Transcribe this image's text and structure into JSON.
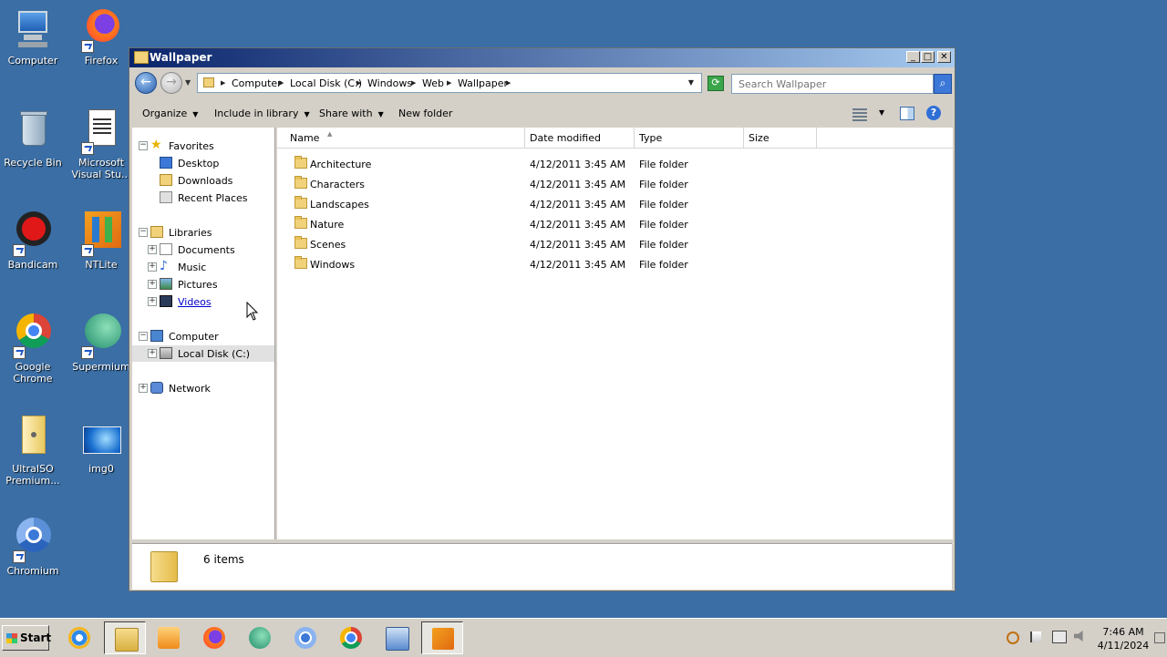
{
  "desktop": {
    "icons": [
      {
        "label": "Computer"
      },
      {
        "label": "Firefox"
      },
      {
        "label": "Recycle Bin"
      },
      {
        "label": "Microsoft Visual Stu..."
      },
      {
        "label": "Bandicam"
      },
      {
        "label": "NTLite"
      },
      {
        "label": "Google Chrome"
      },
      {
        "label": "Supermium"
      },
      {
        "label": "UltraISO Premium..."
      },
      {
        "label": "img0"
      },
      {
        "label": "Chromium"
      }
    ]
  },
  "window": {
    "title": "Wallpaper",
    "controls": {
      "minimize": "_",
      "maximize": "□",
      "close": "✕"
    },
    "address": {
      "crumbs": [
        "Computer",
        "Local Disk (C:)",
        "Windows",
        "Web",
        "Wallpaper"
      ]
    },
    "search": {
      "placeholder": "Search Wallpaper"
    },
    "toolbar": {
      "organize": "Organize",
      "include_in_library": "Include in library",
      "share_with": "Share with",
      "new_folder": "New folder"
    },
    "nav": {
      "favorites": "Favorites",
      "desktop": "Desktop",
      "downloads": "Downloads",
      "recent_places": "Recent Places",
      "libraries": "Libraries",
      "documents": "Documents",
      "music": "Music",
      "pictures": "Pictures",
      "videos": "Videos",
      "computer": "Computer",
      "local_disk": "Local Disk (C:)",
      "network": "Network"
    },
    "columns": {
      "name": "Name",
      "date_modified": "Date modified",
      "type": "Type",
      "size": "Size"
    },
    "files": [
      {
        "name": "Architecture",
        "date": "4/12/2011 3:45 AM",
        "type": "File folder",
        "size": ""
      },
      {
        "name": "Characters",
        "date": "4/12/2011 3:45 AM",
        "type": "File folder",
        "size": ""
      },
      {
        "name": "Landscapes",
        "date": "4/12/2011 3:45 AM",
        "type": "File folder",
        "size": ""
      },
      {
        "name": "Nature",
        "date": "4/12/2011 3:45 AM",
        "type": "File folder",
        "size": ""
      },
      {
        "name": "Scenes",
        "date": "4/12/2011 3:45 AM",
        "type": "File folder",
        "size": ""
      },
      {
        "name": "Windows",
        "date": "4/12/2011 3:45 AM",
        "type": "File folder",
        "size": ""
      }
    ],
    "details": {
      "count": "6 items"
    }
  },
  "taskbar": {
    "start": "Start",
    "time": "7:46 AM",
    "date": "4/11/2024"
  },
  "colors": {
    "desktop": "#3a6ea5",
    "title_start": "#0a246a",
    "title_end": "#a6caf0",
    "folder": "#f1d27a"
  }
}
